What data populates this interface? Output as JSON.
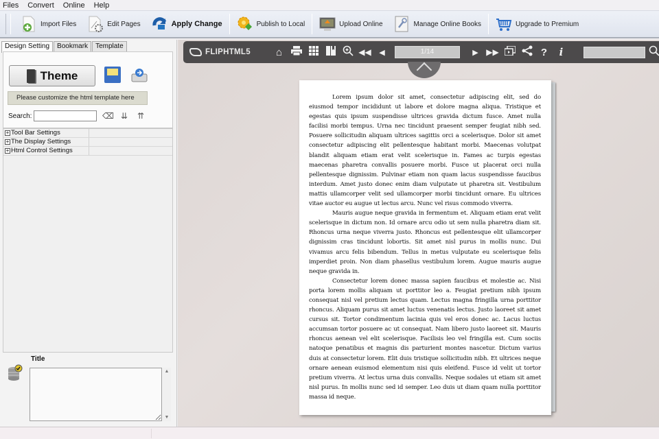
{
  "menu": [
    "Files",
    "Convert",
    "Online",
    "Help"
  ],
  "toolbar": {
    "buttons": [
      {
        "label": "Import Files",
        "icon": "import-files-icon"
      },
      {
        "label": "Edit Pages",
        "icon": "edit-pages-icon"
      },
      {
        "label": "Apply Change",
        "icon": "apply-change-icon"
      },
      {
        "label": "Publish to Local",
        "icon": "publish-local-icon"
      },
      {
        "label": "Upload Online",
        "icon": "upload-online-icon"
      },
      {
        "label": "Manage Online Books",
        "icon": "manage-books-icon"
      },
      {
        "label": "Upgrade to Premium",
        "icon": "cart-icon"
      }
    ]
  },
  "left_panel": {
    "tabs": [
      "Design Setting",
      "Bookmark",
      "Template"
    ],
    "active_tab": "Design Setting",
    "theme_label": "Theme",
    "hint": "Please customize the html template here",
    "search_label": "Search:",
    "search_value": "",
    "tree": [
      {
        "label": "Tool Bar Settings",
        "value": ""
      },
      {
        "label": "The Display Settings",
        "value": ""
      },
      {
        "label": "Html Control Settings",
        "value": ""
      }
    ],
    "title_label": "Title",
    "title_value": ""
  },
  "viewer": {
    "brand": "FLIPHTML5",
    "page_indicator": "1/14",
    "search_value": "",
    "paragraphs": [
      "Lorem ipsum dolor sit amet, consectetur adipiscing elit, sed do eiusmod tempor incididunt ut labore et dolore magna aliqua. Tristique et egestas quis ipsum suspendisse ultrices gravida dictum fusce. Amet nulla facilisi morbi tempus. Urna nec tincidunt praesent semper feugiat nibh sed. Posuere sollicitudin aliquam ultrices sagittis orci a scelerisque. Dolor sit amet consectetur adipiscing elit pellentesque habitant morbi. Maecenas volutpat blandit aliquam etiam erat velit scelerisque in. Fames ac turpis egestas maecenas pharetra convallis posuere morbi. Fusce ut placerat orci nulla pellentesque dignissim. Pulvinar etiam non quam lacus suspendisse faucibus interdum. Amet justo donec enim diam vulputate ut pharetra sit. Vestibulum mattis ullamcorper velit sed ullamcorper morbi tincidunt ornare. Eu ultrices vitae auctor eu augue ut lectus arcu. Nunc vel risus commodo viverra.",
      "Mauris augue neque gravida in fermentum et. Aliquam etiam erat velit scelerisque in dictum non. Id ornare arcu odio ut sem nulla pharetra diam sit. Rhoncus urna neque viverra justo. Rhoncus est pellentesque elit ullamcorper dignissim cras tincidunt lobortis. Sit amet nisl purus in mollis nunc. Dui vivamus arcu felis bibendum. Tellus in metus vulputate eu scelerisque felis imperdiet proin. Non diam phasellus vestibulum lorem. Augue mauris augue neque gravida in.",
      "Consectetur lorem donec massa sapien faucibus et molestie ac. Nisi porta lorem mollis aliquam ut porttitor leo a. Feugiat pretium nibh ipsum consequat nisl vel pretium lectus quam. Lectus magna fringilla urna porttitor rhoncus. Aliquam purus sit amet luctus venenatis lectus. Justo laoreet sit amet cursus sit. Tortor condimentum lacinia quis vel eros donec ac. Lacus luctus accumsan tortor posuere ac ut consequat. Nam libero justo laoreet sit. Mauris rhoncus aenean vel elit scelerisque. Facilisis leo vel fringilla est. Cum sociis natoque penatibus et magnis dis parturient montes nascetur. Dictum varius duis at consectetur lorem. Elit duis tristique sollicitudin nibh. Et ultrices neque ornare aenean euismod elementum nisi quis eleifend. Fusce id velit ut tortor pretium viverra. At lectus urna duis convallis. Neque sodales ut etiam sit amet nisl purus. In mollis nunc sed id semper. Leo duis ut diam quam nulla porttitor massa id neque."
    ]
  }
}
